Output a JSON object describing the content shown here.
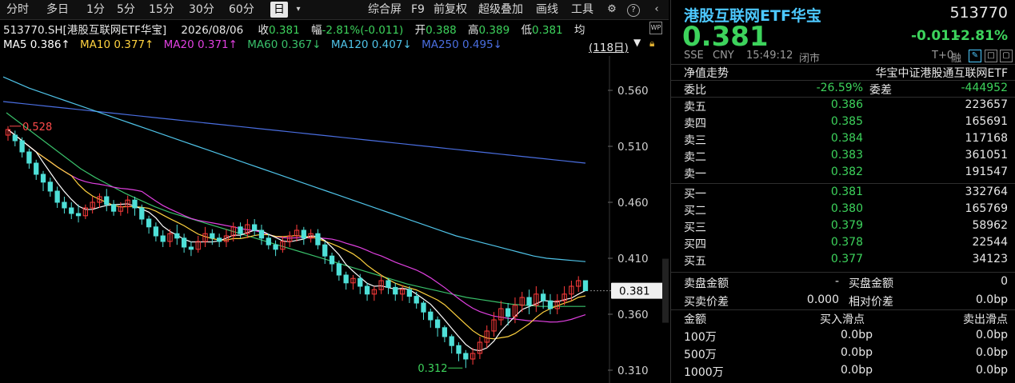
{
  "toolbar": {
    "periods": [
      "分时",
      "多日",
      "1分",
      "5分",
      "15分",
      "30分",
      "60分",
      "日"
    ],
    "active": "日",
    "actions": [
      "综合屏",
      "F9",
      "前复权",
      "超级叠加",
      "画线",
      "工具"
    ]
  },
  "info": {
    "symbol": "513770.SH[港股互联网ETF华宝]",
    "date": "2026/08/06",
    "close_label": "收",
    "close": "0.381",
    "range_label": "幅",
    "range": "-2.81%(-0.011)",
    "open_label": "开",
    "open": "0.388",
    "high_label": "高",
    "high": "0.389",
    "low_label": "低",
    "low": "0.381",
    "avg_label": "均"
  },
  "ma": {
    "ma5": "MA5 0.386↑",
    "ma10": "MA10 0.377↑",
    "ma20": "MA20 0.371↑",
    "ma60": "MA60 0.367↓",
    "ma120": "MA120 0.407↓",
    "ma250": "MA250 0.495↓",
    "days": "(118日)",
    "colors": {
      "ma5": "#ffffff",
      "ma10": "#ffd23f",
      "ma20": "#e040e0",
      "ma60": "#39c06a",
      "ma120": "#4fc3e8",
      "ma250": "#4a6ee0"
    }
  },
  "chart_data": {
    "type": "candlestick",
    "ylim": [
      0.3,
      0.58
    ],
    "y_ticks": [
      "0.560",
      "0.510",
      "0.460",
      "0.410",
      "0.360",
      "0.310"
    ],
    "current_price": "0.381",
    "high_marker": "0.528",
    "low_marker": "0.312",
    "ma250": [
      0.55,
      0.549,
      0.548,
      0.547,
      0.546,
      0.545,
      0.544,
      0.543,
      0.542,
      0.541,
      0.54,
      0.539,
      0.538,
      0.537,
      0.536,
      0.535,
      0.534,
      0.533,
      0.532,
      0.531,
      0.53,
      0.529,
      0.528,
      0.527,
      0.526,
      0.525,
      0.524,
      0.523,
      0.522,
      0.521,
      0.52,
      0.519,
      0.518,
      0.517,
      0.516,
      0.515,
      0.514,
      0.513,
      0.512,
      0.511,
      0.51,
      0.509,
      0.508,
      0.507,
      0.506,
      0.505,
      0.504,
      0.503,
      0.502,
      0.501,
      0.5,
      0.499,
      0.498,
      0.497,
      0.496,
      0.495
    ],
    "ma120": [
      0.572,
      0.567,
      0.562,
      0.558,
      0.554,
      0.55,
      0.546,
      0.542,
      0.538,
      0.534,
      0.53,
      0.526,
      0.522,
      0.518,
      0.514,
      0.51,
      0.506,
      0.502,
      0.498,
      0.494,
      0.49,
      0.486,
      0.482,
      0.478,
      0.474,
      0.47,
      0.466,
      0.462,
      0.458,
      0.454,
      0.45,
      0.446,
      0.442,
      0.438,
      0.434,
      0.43,
      0.427,
      0.424,
      0.421,
      0.418,
      0.415,
      0.412,
      0.41,
      0.409,
      0.408,
      0.407
    ],
    "ma60": [
      0.54,
      0.53,
      0.52,
      0.51,
      0.5,
      0.49,
      0.482,
      0.475,
      0.468,
      0.462,
      0.456,
      0.451,
      0.447,
      0.443,
      0.439,
      0.435,
      0.431,
      0.427,
      0.423,
      0.419,
      0.415,
      0.411,
      0.407,
      0.403,
      0.399,
      0.395,
      0.391,
      0.387,
      0.384,
      0.381,
      0.378,
      0.375,
      0.373,
      0.371,
      0.369,
      0.368,
      0.367,
      0.367,
      0.367,
      0.367
    ],
    "candles": [
      [
        0.52,
        0.525,
        0.515,
        0.528
      ],
      [
        0.52,
        0.515,
        0.51,
        0.524
      ],
      [
        0.515,
        0.505,
        0.5,
        0.518
      ],
      [
        0.505,
        0.495,
        0.49,
        0.508
      ],
      [
        0.495,
        0.485,
        0.48,
        0.498
      ],
      [
        0.485,
        0.478,
        0.47,
        0.488
      ],
      [
        0.478,
        0.47,
        0.465,
        0.482
      ],
      [
        0.47,
        0.46,
        0.455,
        0.474
      ],
      [
        0.46,
        0.455,
        0.45,
        0.465
      ],
      [
        0.455,
        0.45,
        0.445,
        0.46
      ],
      [
        0.45,
        0.448,
        0.442,
        0.458
      ],
      [
        0.448,
        0.455,
        0.445,
        0.458
      ],
      [
        0.455,
        0.46,
        0.45,
        0.465
      ],
      [
        0.46,
        0.465,
        0.455,
        0.468
      ],
      [
        0.465,
        0.458,
        0.452,
        0.472
      ],
      [
        0.458,
        0.452,
        0.448,
        0.462
      ],
      [
        0.452,
        0.456,
        0.448,
        0.46
      ],
      [
        0.456,
        0.462,
        0.45,
        0.466
      ],
      [
        0.462,
        0.455,
        0.448,
        0.465
      ],
      [
        0.455,
        0.445,
        0.44,
        0.458
      ],
      [
        0.445,
        0.438,
        0.432,
        0.448
      ],
      [
        0.438,
        0.43,
        0.425,
        0.442
      ],
      [
        0.43,
        0.425,
        0.42,
        0.435
      ],
      [
        0.425,
        0.432,
        0.42,
        0.436
      ],
      [
        0.432,
        0.428,
        0.422,
        0.44
      ],
      [
        0.428,
        0.42,
        0.415,
        0.432
      ],
      [
        0.42,
        0.418,
        0.412,
        0.425
      ],
      [
        0.418,
        0.425,
        0.415,
        0.43
      ],
      [
        0.425,
        0.432,
        0.42,
        0.438
      ],
      [
        0.432,
        0.428,
        0.422,
        0.436
      ],
      [
        0.428,
        0.425,
        0.42,
        0.432
      ],
      [
        0.425,
        0.43,
        0.42,
        0.436
      ],
      [
        0.43,
        0.438,
        0.425,
        0.442
      ],
      [
        0.438,
        0.432,
        0.428,
        0.442
      ],
      [
        0.432,
        0.44,
        0.428,
        0.445
      ],
      [
        0.44,
        0.435,
        0.43,
        0.445
      ],
      [
        0.435,
        0.428,
        0.422,
        0.44
      ],
      [
        0.428,
        0.422,
        0.418,
        0.432
      ],
      [
        0.422,
        0.418,
        0.412,
        0.426
      ],
      [
        0.418,
        0.425,
        0.415,
        0.43
      ],
      [
        0.425,
        0.43,
        0.42,
        0.434
      ],
      [
        0.43,
        0.435,
        0.425,
        0.44
      ],
      [
        0.435,
        0.428,
        0.422,
        0.438
      ],
      [
        0.428,
        0.432,
        0.424,
        0.436
      ],
      [
        0.432,
        0.422,
        0.418,
        0.436
      ],
      [
        0.422,
        0.412,
        0.405,
        0.425
      ],
      [
        0.412,
        0.405,
        0.398,
        0.415
      ],
      [
        0.405,
        0.395,
        0.39,
        0.408
      ],
      [
        0.395,
        0.388,
        0.382,
        0.398
      ],
      [
        0.388,
        0.392,
        0.382,
        0.395
      ],
      [
        0.392,
        0.385,
        0.378,
        0.396
      ],
      [
        0.385,
        0.378,
        0.372,
        0.388
      ],
      [
        0.378,
        0.382,
        0.372,
        0.385
      ],
      [
        0.382,
        0.39,
        0.378,
        0.395
      ],
      [
        0.39,
        0.384,
        0.378,
        0.392
      ],
      [
        0.384,
        0.378,
        0.372,
        0.388
      ],
      [
        0.378,
        0.382,
        0.372,
        0.386
      ],
      [
        0.382,
        0.376,
        0.37,
        0.385
      ],
      [
        0.376,
        0.37,
        0.365,
        0.38
      ],
      [
        0.37,
        0.362,
        0.355,
        0.372
      ],
      [
        0.362,
        0.355,
        0.348,
        0.365
      ],
      [
        0.355,
        0.348,
        0.34,
        0.358
      ],
      [
        0.348,
        0.34,
        0.335,
        0.35
      ],
      [
        0.34,
        0.332,
        0.325,
        0.342
      ],
      [
        0.332,
        0.325,
        0.318,
        0.335
      ],
      [
        0.325,
        0.32,
        0.312,
        0.328
      ],
      [
        0.32,
        0.325,
        0.315,
        0.33
      ],
      [
        0.325,
        0.335,
        0.32,
        0.34
      ],
      [
        0.335,
        0.345,
        0.33,
        0.35
      ],
      [
        0.345,
        0.355,
        0.34,
        0.362
      ],
      [
        0.355,
        0.365,
        0.35,
        0.372
      ],
      [
        0.365,
        0.358,
        0.35,
        0.37
      ],
      [
        0.358,
        0.368,
        0.352,
        0.375
      ],
      [
        0.368,
        0.375,
        0.362,
        0.38
      ],
      [
        0.375,
        0.368,
        0.36,
        0.382
      ],
      [
        0.368,
        0.378,
        0.362,
        0.385
      ],
      [
        0.378,
        0.372,
        0.365,
        0.382
      ],
      [
        0.372,
        0.365,
        0.36,
        0.378
      ],
      [
        0.365,
        0.372,
        0.36,
        0.378
      ],
      [
        0.372,
        0.378,
        0.368,
        0.385
      ],
      [
        0.378,
        0.385,
        0.372,
        0.39
      ],
      [
        0.385,
        0.39,
        0.38,
        0.394
      ],
      [
        0.39,
        0.381,
        0.381,
        0.389
      ]
    ]
  },
  "quote": {
    "name": "港股互联网ETF华宝",
    "code": "513770",
    "price": "0.381",
    "change": "-0.011",
    "change_pct": "-2.81%",
    "exchange": "SSE",
    "currency": "CNY",
    "time": "15:49:12",
    "status": "闭市",
    "t0": "T+0",
    "margin": "融",
    "nav_label": "净值走势",
    "nav_name": "华宝中证港股通互联网ETF",
    "ratio_label": "委比",
    "ratio": "-26.59%",
    "diff_label": "委差",
    "diff": "-444952"
  },
  "orderbook": {
    "asks": [
      {
        "label": "卖五",
        "price": "0.386",
        "vol": "223657"
      },
      {
        "label": "卖四",
        "price": "0.385",
        "vol": "165691"
      },
      {
        "label": "卖三",
        "price": "0.384",
        "vol": "117168"
      },
      {
        "label": "卖二",
        "price": "0.383",
        "vol": "361051"
      },
      {
        "label": "卖一",
        "price": "0.382",
        "vol": "191547"
      }
    ],
    "bids": [
      {
        "label": "买一",
        "price": "0.381",
        "vol": "332764"
      },
      {
        "label": "买二",
        "price": "0.380",
        "vol": "165769"
      },
      {
        "label": "买三",
        "price": "0.379",
        "vol": "58962"
      },
      {
        "label": "买四",
        "price": "0.378",
        "vol": "22544"
      },
      {
        "label": "买五",
        "price": "0.377",
        "vol": "34123"
      }
    ]
  },
  "stats": {
    "sell_amt_label": "卖盘金额",
    "sell_amt": "-",
    "buy_amt_label": "买盘金额",
    "buy_amt": "0",
    "spread_label": "买卖价差",
    "spread": "0.000",
    "rel_spread_label": "相对价差",
    "rel_spread": "0.0bp",
    "amt_label": "金额",
    "buy_slip_label": "买入滑点",
    "sell_slip_label": "卖出滑点",
    "slips": [
      {
        "amt": "100万",
        "buy": "0.0bp",
        "sell": "0.0bp"
      },
      {
        "amt": "500万",
        "buy": "0.0bp",
        "sell": "0.0bp"
      },
      {
        "amt": "1000万",
        "buy": "0.0bp",
        "sell": "0.0bp"
      }
    ]
  }
}
